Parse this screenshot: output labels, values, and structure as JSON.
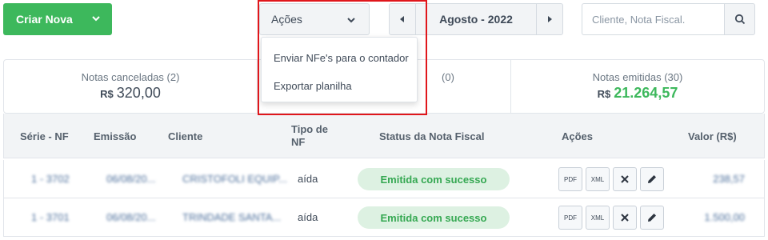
{
  "toolbar": {
    "create_label": "Criar Nova",
    "actions_label": "Ações",
    "month_label": "Agosto",
    "month_sep": " - ",
    "year_label": "2022",
    "search_placeholder": "Cliente, Nota Fiscal."
  },
  "actions_menu": {
    "items": [
      "Enviar NFe's para o contador",
      "Exportar planilha"
    ]
  },
  "summary": [
    {
      "label": "Notas canceladas (2)",
      "currency": "R$",
      "value": "320,00"
    },
    {
      "label": "(0)",
      "currency": "",
      "value": ""
    },
    {
      "label": "Notas emitidas (30)",
      "currency": "R$",
      "value": "21.264,57"
    }
  ],
  "table": {
    "headers": {
      "serie": "Série - NF",
      "emissao": "Emissão",
      "cliente": "Cliente",
      "tipo_line1": "Tipo de",
      "tipo_line2": "NF",
      "status": "Status da Nota Fiscal",
      "acoes": "Ações",
      "valor": "Valor (R$)"
    },
    "rows": [
      {
        "serie": "1 - 3702",
        "emissao": "06/08/20...",
        "cliente": "CRISTOFOLI EQUIP...",
        "tipo": "aída",
        "status": "Emitida com sucesso",
        "valor": "238,57"
      },
      {
        "serie": "1 - 3701",
        "emissao": "06/08/20...",
        "cliente": "TRINDADE SANTA...",
        "tipo": "aída",
        "status": "Emitida com sucesso",
        "valor": "1.500,00"
      }
    ],
    "action_buttons": {
      "pdf": "PDF",
      "xml": "XML"
    }
  },
  "colors": {
    "brand_green": "#3db85c",
    "highlight_red": "#e0161b",
    "status_bg": "#ddf1e2"
  },
  "icons": [
    "chevron-down-icon",
    "caret-left-icon",
    "caret-right-icon",
    "search-icon",
    "close-icon",
    "pencil-icon"
  ]
}
